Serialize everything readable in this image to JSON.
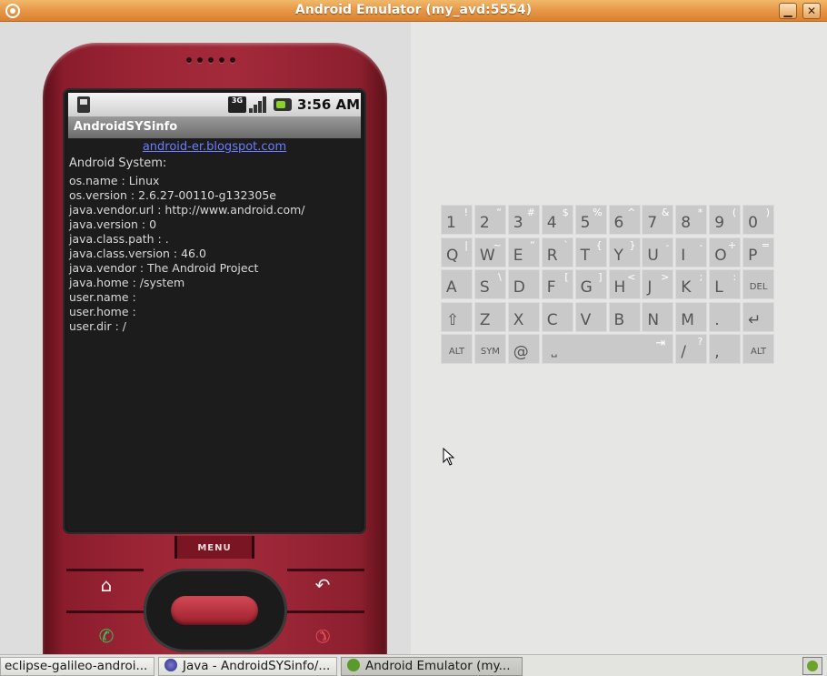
{
  "window": {
    "title": "Android Emulator (my_avd:5554)",
    "minimize_label": "▁",
    "close_label": "✕"
  },
  "status_bar": {
    "network_label": "3G",
    "time": "3:56 AM"
  },
  "app": {
    "title": "AndroidSYSinfo",
    "link": "android-er.blogspot.com",
    "heading": "Android System:",
    "properties": [
      "os.name : Linux",
      "os.version : 2.6.27-00110-g132305e",
      "java.vendor.url : http://www.android.com/",
      "java.version : 0",
      "java.class.path : .",
      "java.class.version : 46.0",
      "java.vendor : The Android Project",
      "java.home : /system",
      "user.name :",
      "user.home :",
      "user.dir : /"
    ]
  },
  "hardware": {
    "menu_label": "MENU",
    "home_icon": "⌂",
    "back_icon": "↶",
    "call_icon": "✆",
    "end_icon": "✆"
  },
  "keyboard": {
    "row1": [
      [
        "1",
        "!"
      ],
      [
        "2",
        "“"
      ],
      [
        "3",
        "#"
      ],
      [
        "4",
        "$"
      ],
      [
        "5",
        "%"
      ],
      [
        "6",
        "^"
      ],
      [
        "7",
        "&"
      ],
      [
        "8",
        "*"
      ],
      [
        "9",
        "("
      ],
      [
        "0",
        ")"
      ]
    ],
    "row2": [
      [
        "Q",
        "|"
      ],
      [
        "W",
        "~"
      ],
      [
        "E",
        "“"
      ],
      [
        "R",
        "`"
      ],
      [
        "T",
        "{"
      ],
      [
        "Y",
        "}"
      ],
      [
        "U",
        "-"
      ],
      [
        "I",
        "-"
      ],
      [
        "O",
        "+"
      ],
      [
        "P",
        "="
      ]
    ],
    "row3": [
      [
        "A",
        ""
      ],
      [
        "S",
        "\\"
      ],
      [
        "D",
        ""
      ],
      [
        "F",
        "["
      ],
      [
        "G",
        "]"
      ],
      [
        "H",
        "<"
      ],
      [
        "J",
        ">"
      ],
      [
        "K",
        ";"
      ],
      [
        "L",
        ":"
      ],
      [
        "DEL",
        ""
      ]
    ],
    "row4": [
      [
        "⇧",
        ""
      ],
      [
        "Z",
        ""
      ],
      [
        "X",
        ""
      ],
      [
        "C",
        ""
      ],
      [
        "V",
        ""
      ],
      [
        "B",
        ""
      ],
      [
        "N",
        ""
      ],
      [
        "M",
        ""
      ],
      [
        ".",
        ""
      ],
      [
        "↵",
        ""
      ]
    ],
    "row5": {
      "alt_left": "ALT",
      "sym": "SYM",
      "at": "@",
      "space": "⎵",
      "tab": "⇥",
      "slash": "/",
      "slash_alt": "?",
      "comma": ",",
      "alt_right": "ALT"
    }
  },
  "taskbar": {
    "items": [
      "eclipse-galileo-androi...",
      "Java - AndroidSYSinfo/...",
      "Android Emulator (my..."
    ]
  }
}
